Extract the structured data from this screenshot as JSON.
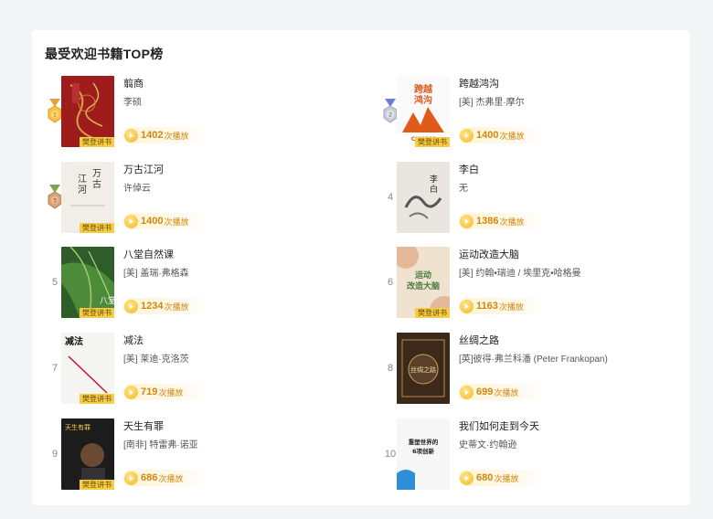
{
  "section_title": "最受欢迎书籍TOP榜",
  "cover_tag": "樊登讲书",
  "play_unit": "次播放",
  "books": [
    {
      "rank": "1",
      "title": "翦商",
      "author": "李硕",
      "plays": "1402",
      "medal": "gold-medal-icon"
    },
    {
      "rank": "2",
      "title": "跨越鸿沟",
      "author": "[美] 杰弗里·摩尔",
      "plays": "1400",
      "medal": "silver-medal-icon"
    },
    {
      "rank": "3",
      "title": "万古江河",
      "author": "许倬云",
      "plays": "1400",
      "medal": "bronze-medal-icon"
    },
    {
      "rank": "4",
      "title": "李白",
      "author": "无",
      "plays": "1386"
    },
    {
      "rank": "5",
      "title": "八堂自然课",
      "author": "[美] 盖瑞·弗格森",
      "plays": "1234"
    },
    {
      "rank": "6",
      "title": "运动改造大脑",
      "author": "[美] 约翰•瑞迪 / 埃里克•哈格曼",
      "plays": "1163"
    },
    {
      "rank": "7",
      "title": "减法",
      "author": "[美] 莱迪·克洛茨",
      "plays": "719"
    },
    {
      "rank": "8",
      "title": "丝绸之路",
      "author": "[英]彼得·弗兰科潘 (Peter Frankopan)",
      "plays": "699"
    },
    {
      "rank": "9",
      "title": "天生有罪",
      "author": "[南非] 特雷弗·诺亚",
      "plays": "686"
    },
    {
      "rank": "10",
      "title": "我们如何走到今天",
      "author": "史蒂文·约翰逊",
      "plays": "680"
    }
  ],
  "covers": {
    "b2": "跨越鸿沟",
    "b3": "江万河古",
    "b4": "李白",
    "b5": "八堂",
    "b6": "运动改造大脑",
    "b7": "减法",
    "b8": "丝绸之路",
    "b9": "天生有罪",
    "b10": "重塑世界的6项创新"
  }
}
